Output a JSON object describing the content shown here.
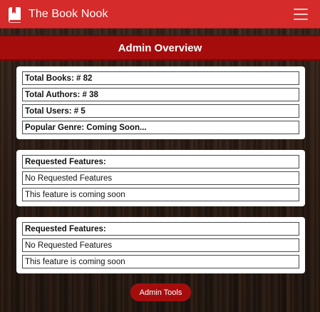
{
  "navbar": {
    "brand_title": "The Book Nook",
    "brand_icon": "book-icon",
    "menu_icon": "hamburger-menu-icon",
    "color": "#d62b2b"
  },
  "header": {
    "title": "Admin Overview",
    "color": "#a50d0d"
  },
  "stats": {
    "total_books": "Total Books: # 82",
    "total_authors": "Total Authors: # 38",
    "total_users": "Total Users: # 5",
    "popular_genre": "Popular Genre: Coming Soon..."
  },
  "features_cards": [
    {
      "heading": "Requested Features:",
      "rows": [
        "No Requested Features",
        "This feature is coming soon"
      ]
    },
    {
      "heading": "Requested Features:",
      "rows": [
        "No Requested Features",
        "This feature is coming soon"
      ]
    }
  ],
  "footer": {
    "admin_tools_label": "Admin Tools"
  }
}
